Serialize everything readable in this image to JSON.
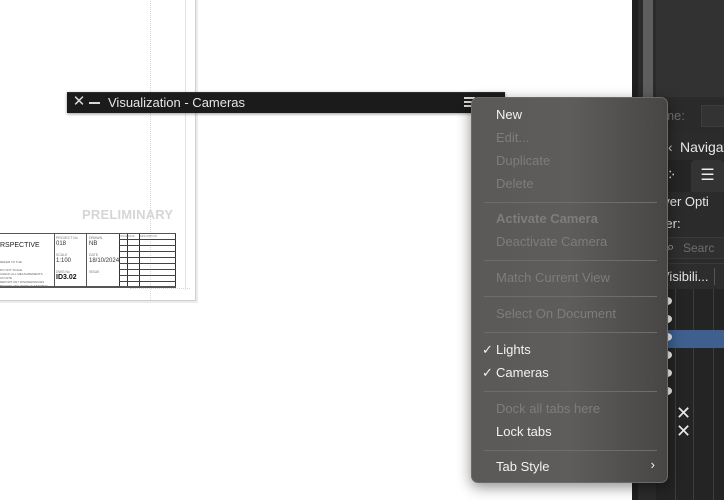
{
  "canvas": {
    "watermark": "PRELIMINARY",
    "title_block": {
      "drawing_name": "RSPECTIVE",
      "notes": "REFER TO THE\nDO NOT SCALE\nCHECK ALL MEASUREMENTS\nON SITE\nREPORT ANY DISCREPANCIES\nBEFORE ANY WORK IS STARTED",
      "project_no_label": "PROJECT No",
      "project_no": "018",
      "drawn_label": "DRAWN",
      "drawn": "NB",
      "scale_label": "SCALE",
      "scale": "1:100",
      "date_label": "DATE",
      "date": "18/10/2024",
      "dwg_no_label": "DWG No",
      "dwg_no": "ID3.02",
      "issue_label": "ISSUE",
      "revision_headers": [
        "ISSUE",
        "DATE",
        "DESCRIPTION"
      ]
    }
  },
  "panel": {
    "title": "Visualization - Cameras",
    "close_icon": "close-icon",
    "minimize_icon": "minimize-icon",
    "menu_icon": "hamburger-menu-icon"
  },
  "menu": {
    "items": [
      {
        "label": "New",
        "enabled": true
      },
      {
        "label": "Edit...",
        "enabled": false
      },
      {
        "label": "Duplicate",
        "enabled": false
      },
      {
        "label": "Delete",
        "enabled": false
      },
      {
        "label": "Activate Camera",
        "enabled": false,
        "bold": true
      },
      {
        "label": "Deactivate Camera",
        "enabled": false
      },
      {
        "label": "Match Current View",
        "enabled": false
      },
      {
        "label": "Select On Document",
        "enabled": false
      },
      {
        "label": "Lights",
        "enabled": true,
        "checked": true
      },
      {
        "label": "Cameras",
        "enabled": true,
        "checked": true
      },
      {
        "label": "Dock all tabs here",
        "enabled": false
      },
      {
        "label": "Lock tabs",
        "enabled": true
      },
      {
        "label": "Tab Style",
        "enabled": true,
        "submenu": true
      }
    ],
    "check_glyph": "✓",
    "submenu_glyph": "›"
  },
  "right_panel": {
    "name_label": "ame:",
    "navigator_label": "Navigat",
    "navigator_chevron": "‹",
    "layer_options_label": "ayer Opti",
    "filter_label": "ilter:",
    "search_placeholder": "Searc",
    "column_header": "Visibili...",
    "rows": [
      {
        "visible": true,
        "selected": false
      },
      {
        "visible": true,
        "selected": false
      },
      {
        "visible": true,
        "selected": true
      },
      {
        "visible": true,
        "selected": false
      },
      {
        "visible": true,
        "selected": false
      },
      {
        "visible": true,
        "selected": false
      },
      {
        "visible": false,
        "marker": "✕"
      },
      {
        "visible": false,
        "marker": "✕"
      }
    ]
  },
  "colors": {
    "menu_bg": "#5a5958",
    "panel_bar": "#1b1b1b",
    "selected_row": "#3f5f8f",
    "disabled_text": "#7e7d7b"
  }
}
